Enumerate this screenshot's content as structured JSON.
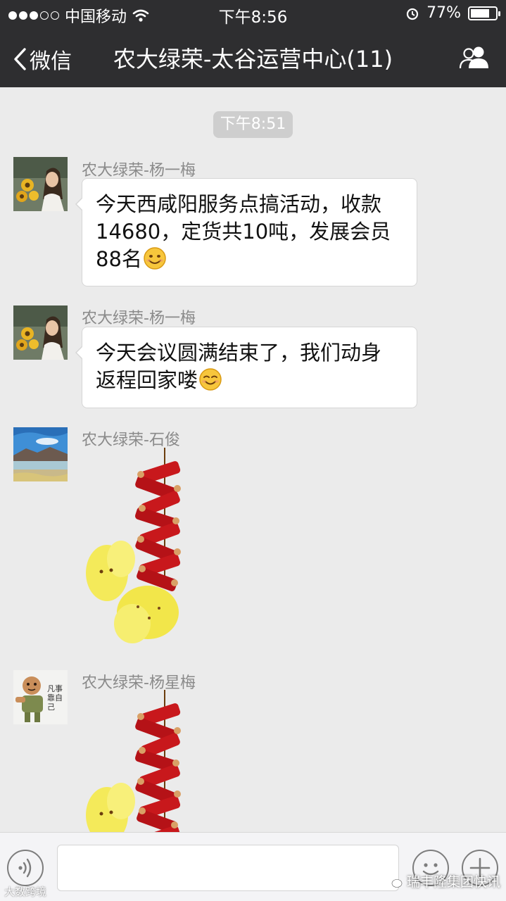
{
  "status_bar": {
    "carrier": "中国移动",
    "time": "下午8:56",
    "battery": "77%",
    "battery_level": 0.77
  },
  "nav": {
    "back_label": "微信",
    "title": "农大绿荣-太谷运营中心(11)"
  },
  "chat": {
    "timestamp": "下午8:51",
    "messages": [
      {
        "sender": "农大绿荣-杨一梅",
        "type": "text",
        "lines": [
          "今天西咸阳服务点搞活动，收款",
          "14680，定货共10吨，发展会员",
          "88名"
        ]
      },
      {
        "sender": "农大绿荣-杨一梅",
        "type": "text",
        "lines": [
          "今天会议圆满结束了，我们动身",
          "返程回家喽"
        ]
      },
      {
        "sender": "农大绿荣-石俊",
        "type": "sticker",
        "sticker": "firecrackers"
      },
      {
        "sender": "农大绿荣-杨星梅",
        "type": "sticker",
        "sticker": "firecrackers"
      }
    ]
  },
  "avatars": {
    "yang_yimei_text": "",
    "yang_xingmei_text": "凡事靠自己"
  },
  "watermarks": {
    "left": "大数跨境",
    "right": "瑞丰隆集团快讯"
  },
  "colors": {
    "bar": "#2e2e30",
    "chat_bg": "#ebebeb",
    "timestamp_bg": "#cecece"
  },
  "icons": [
    "wifi-icon",
    "alarm-icon",
    "back-chevron-icon",
    "group-members-icon",
    "voice-icon",
    "emoji-icon",
    "plus-icon",
    "smile-emoji-icon"
  ]
}
